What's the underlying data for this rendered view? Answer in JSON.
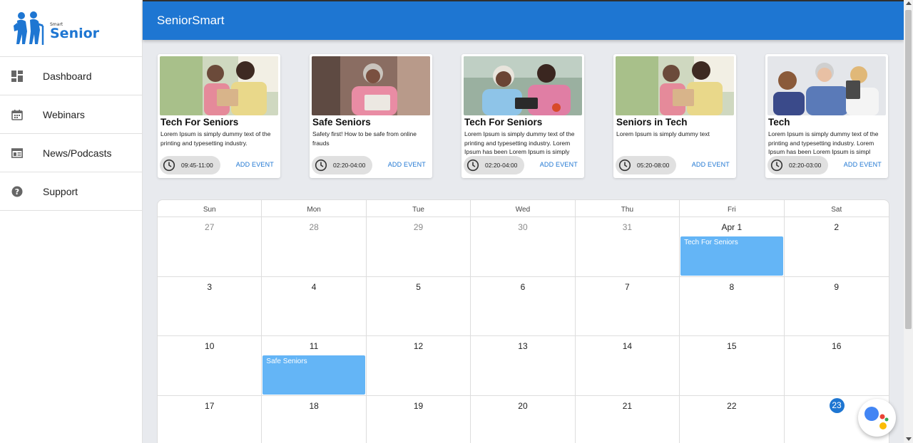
{
  "app": {
    "logo_small": "Smart",
    "logo_big": "Senior",
    "title": "SeniorSmart"
  },
  "sidebar": {
    "items": [
      {
        "label": "Dashboard",
        "icon": "dashboard-icon"
      },
      {
        "label": "Webinars",
        "icon": "calendar-icon"
      },
      {
        "label": "News/Podcasts",
        "icon": "news-icon"
      },
      {
        "label": "Support",
        "icon": "help-icon"
      }
    ]
  },
  "cards": [
    {
      "title": "Tech For Seniors",
      "description": "Lorem Ipsum is simply dummy text of the printing and typesetting industry.",
      "time": "09:45-11:00",
      "action": "ADD EVENT"
    },
    {
      "title": "Safe Seniors",
      "description": "Safety first! How to be safe from online frauds",
      "time": "02:20-04:00",
      "action": "ADD EVENT"
    },
    {
      "title": "Tech For Seniors",
      "description": "Lorem Ipsum is simply dummy text of the printing and typesetting industry. Lorem Ipsum has been Lorem Ipsum is simply",
      "time": "02:20-04:00",
      "action": "ADD EVENT"
    },
    {
      "title": "Seniors in Tech",
      "description": "Lorem Ipsum is simply dummy text",
      "time": "05:20-08:00",
      "action": "ADD EVENT"
    },
    {
      "title": "Tech",
      "description": "Lorem Ipsum is simply dummy text of the printing and typesetting industry. Lorem Ipsum has been Lorem Ipsum is simpl",
      "time": "02:20-03:00",
      "action": "ADD EVENT"
    }
  ],
  "calendar": {
    "weekdays": [
      "Sun",
      "Mon",
      "Tue",
      "Wed",
      "Thu",
      "Fri",
      "Sat"
    ],
    "weeks": [
      [
        "27",
        "28",
        "29",
        "30",
        "31",
        "Apr 1",
        "2"
      ],
      [
        "3",
        "4",
        "5",
        "6",
        "7",
        "8",
        "9"
      ],
      [
        "10",
        "11",
        "12",
        "13",
        "14",
        "15",
        "16"
      ],
      [
        "17",
        "18",
        "19",
        "20",
        "21",
        "22",
        "23"
      ]
    ],
    "today": "23",
    "events": [
      {
        "title": "Tech For Seniors",
        "day": "Apr 1"
      },
      {
        "title": "Safe Seniors",
        "day": "11"
      }
    ]
  },
  "colors": {
    "primary": "#1e76d2",
    "event": "#64b5f6",
    "background": "#e8eaee"
  }
}
